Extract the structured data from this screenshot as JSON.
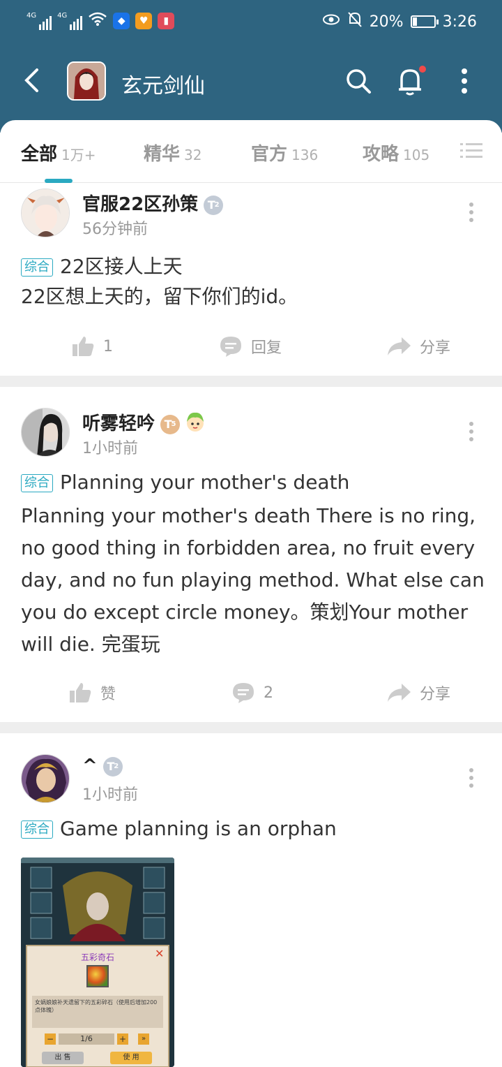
{
  "status_bar": {
    "net1": "4G",
    "net2": "4G",
    "battery": "20%",
    "time": "3:26"
  },
  "header": {
    "title": "玄元剑仙"
  },
  "tabs": [
    {
      "label": "全部",
      "count": "1万+"
    },
    {
      "label": "精华",
      "count": "32"
    },
    {
      "label": "官方",
      "count": "136"
    },
    {
      "label": "攻略",
      "count": "105"
    }
  ],
  "posts": [
    {
      "user": "官服22区孙策",
      "badge": "T",
      "badge_level": "2",
      "time": "56分钟前",
      "tag": "综合",
      "title": "22区接人上天",
      "body": "22区想上天的，留下你们的id。",
      "like": "1",
      "comment": "回复",
      "share": "分享"
    },
    {
      "user": "听雾轻吟",
      "badge": "T",
      "badge_level": "5",
      "time": "1小时前",
      "tag": "综合",
      "title": "Planning your mother's death",
      "body": "Planning your mother's death There is no ring,  no good thing in forbidden area,  no fruit every day,  and no fun playing method.  What else can you do except circle money。策划Your mother will die. 完蛋玩",
      "like": "赞",
      "comment": "2",
      "share": "分享"
    },
    {
      "user": "^",
      "badge": "T",
      "badge_level": "2",
      "time": "1小时前",
      "tag": "综合",
      "title": "Game planning is an orphan"
    }
  ],
  "screenshot": {
    "item_name": "五彩奇石",
    "desc": "女娲娘娘补天遗留下的五彩碎石（使用后增加200点体魄）",
    "qty": "1/6",
    "btn_sell": "出 售",
    "btn_use": "使 用"
  }
}
